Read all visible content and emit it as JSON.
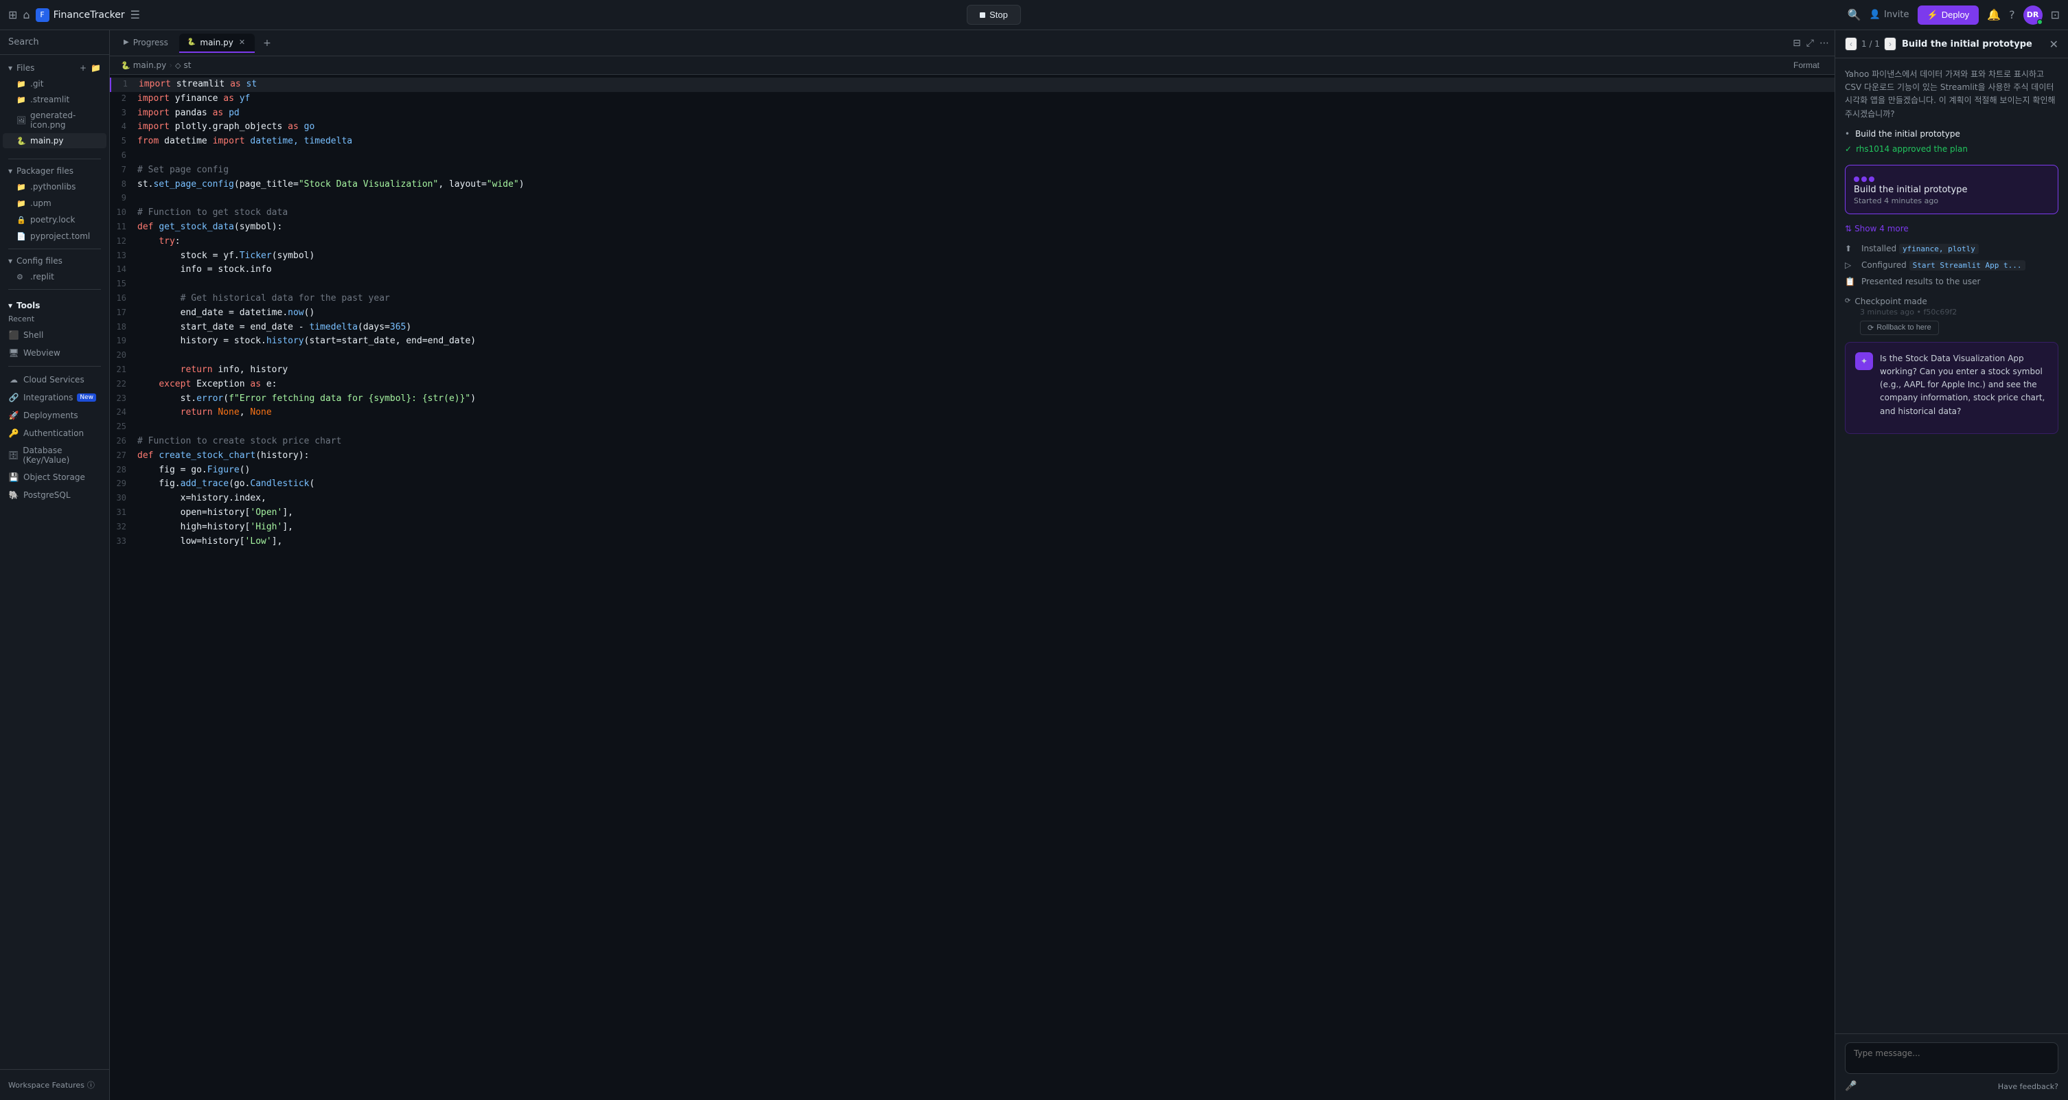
{
  "topbar": {
    "brand": "FinanceTracker",
    "stop_label": "Stop",
    "invite_label": "Invite",
    "deploy_label": "Deploy",
    "avatar_initials": "DR"
  },
  "sidebar": {
    "search_label": "Search",
    "files_section": "Files",
    "file_items": [
      {
        "name": ".git",
        "icon": "📁"
      },
      {
        "name": ".streamlit",
        "icon": "📁"
      },
      {
        "name": "generated-icon.png",
        "icon": "🖼"
      },
      {
        "name": "main.py",
        "icon": "🐍",
        "active": true
      }
    ],
    "packager_label": "Packager files",
    "packager_items": [
      {
        "name": ".pythonlibs",
        "icon": "📁"
      },
      {
        "name": ".upm",
        "icon": "📁"
      },
      {
        "name": "poetry.lock",
        "icon": "🔒"
      },
      {
        "name": "pyproject.toml",
        "icon": "📄"
      }
    ],
    "config_label": "Config files",
    "config_items": [
      {
        "name": ".replit",
        "icon": "⚙"
      }
    ],
    "tools_label": "Tools",
    "recent_label": "Recent",
    "tools_items": [
      {
        "name": "Cloud Services",
        "icon": "☁",
        "badge": ""
      },
      {
        "name": "Integrations",
        "icon": "🔗",
        "badge": "New"
      },
      {
        "name": "Deployments",
        "icon": "🚀",
        "badge": ""
      },
      {
        "name": "Authentication",
        "icon": "🔑",
        "badge": ""
      },
      {
        "name": "Database (Key/Value)",
        "icon": "🗄",
        "badge": ""
      },
      {
        "name": "Object Storage",
        "icon": "💾",
        "badge": ""
      },
      {
        "name": "PostgreSQL",
        "icon": "🐘",
        "badge": ""
      }
    ],
    "workspace_label": "Workspace Features"
  },
  "editor": {
    "tabs": [
      {
        "label": "Progress",
        "icon": "▶",
        "active": false
      },
      {
        "label": "main.py",
        "icon": "🐍",
        "active": true,
        "closeable": true
      }
    ],
    "breadcrumb": [
      {
        "label": "main.py",
        "icon": "🐍"
      },
      {
        "label": "st",
        "icon": "◇"
      }
    ],
    "format_label": "Format",
    "code_lines": [
      {
        "num": 1,
        "tokens": [
          {
            "t": "kw",
            "v": "import"
          },
          {
            "t": "var",
            "v": " streamlit "
          },
          {
            "t": "kw",
            "v": "as"
          },
          {
            "t": "import-name",
            "v": " st"
          }
        ]
      },
      {
        "num": 2,
        "tokens": [
          {
            "t": "kw",
            "v": "import"
          },
          {
            "t": "var",
            "v": " yfinance "
          },
          {
            "t": "kw",
            "v": "as"
          },
          {
            "t": "import-name",
            "v": " yf"
          }
        ]
      },
      {
        "num": 3,
        "tokens": [
          {
            "t": "kw",
            "v": "import"
          },
          {
            "t": "var",
            "v": " pandas "
          },
          {
            "t": "kw",
            "v": "as"
          },
          {
            "t": "import-name",
            "v": " pd"
          }
        ]
      },
      {
        "num": 4,
        "tokens": [
          {
            "t": "kw",
            "v": "import"
          },
          {
            "t": "var",
            "v": " plotly.graph_objects "
          },
          {
            "t": "kw",
            "v": "as"
          },
          {
            "t": "import-name",
            "v": " go"
          }
        ]
      },
      {
        "num": 5,
        "tokens": [
          {
            "t": "kw",
            "v": "from"
          },
          {
            "t": "var",
            "v": " datetime "
          },
          {
            "t": "kw",
            "v": "import"
          },
          {
            "t": "import-name",
            "v": " datetime, timedelta"
          }
        ]
      },
      {
        "num": 6,
        "tokens": []
      },
      {
        "num": 7,
        "tokens": [
          {
            "t": "comment",
            "v": "# Set page config"
          }
        ]
      },
      {
        "num": 8,
        "tokens": [
          {
            "t": "var",
            "v": "st"
          },
          {
            "t": "punc",
            "v": "."
          },
          {
            "t": "fn",
            "v": "set_page_config"
          },
          {
            "t": "punc",
            "v": "("
          },
          {
            "t": "var",
            "v": "page_title"
          },
          {
            "t": "punc",
            "v": "="
          },
          {
            "t": "str",
            "v": "\"Stock Data Visualization\""
          },
          {
            "t": "punc",
            "v": ", "
          },
          {
            "t": "var",
            "v": "layout"
          },
          {
            "t": "punc",
            "v": "="
          },
          {
            "t": "str",
            "v": "\"wide\""
          },
          {
            "t": "punc",
            "v": ")"
          }
        ]
      },
      {
        "num": 9,
        "tokens": []
      },
      {
        "num": 10,
        "tokens": [
          {
            "t": "comment",
            "v": "# Function to get stock data"
          }
        ]
      },
      {
        "num": 11,
        "tokens": [
          {
            "t": "kw",
            "v": "def"
          },
          {
            "t": "var",
            "v": " "
          },
          {
            "t": "fn",
            "v": "get_stock_data"
          },
          {
            "t": "punc",
            "v": "("
          },
          {
            "t": "var",
            "v": "symbol"
          },
          {
            "t": "punc",
            "v": "):"
          }
        ]
      },
      {
        "num": 12,
        "tokens": [
          {
            "t": "var",
            "v": "    "
          },
          {
            "t": "kw",
            "v": "try"
          },
          {
            "t": "punc",
            "v": ":"
          }
        ]
      },
      {
        "num": 13,
        "tokens": [
          {
            "t": "var",
            "v": "        stock = yf."
          },
          {
            "t": "fn",
            "v": "Ticker"
          },
          {
            "t": "punc",
            "v": "("
          },
          {
            "t": "var",
            "v": "symbol"
          },
          {
            "t": "punc",
            "v": ")"
          }
        ]
      },
      {
        "num": 14,
        "tokens": [
          {
            "t": "var",
            "v": "        info = stock.info"
          }
        ]
      },
      {
        "num": 15,
        "tokens": []
      },
      {
        "num": 16,
        "tokens": [
          {
            "t": "comment",
            "v": "        # Get historical data for the past year"
          }
        ]
      },
      {
        "num": 17,
        "tokens": [
          {
            "t": "var",
            "v": "        end_date = datetime."
          },
          {
            "t": "fn",
            "v": "now"
          },
          {
            "t": "punc",
            "v": "()"
          }
        ]
      },
      {
        "num": 18,
        "tokens": [
          {
            "t": "var",
            "v": "        start_date = end_date - "
          },
          {
            "t": "fn",
            "v": "timedelta"
          },
          {
            "t": "punc",
            "v": "("
          },
          {
            "t": "var",
            "v": "days"
          },
          {
            "t": "punc",
            "v": "="
          },
          {
            "t": "num",
            "v": "365"
          },
          {
            "t": "punc",
            "v": ")"
          }
        ]
      },
      {
        "num": 19,
        "tokens": [
          {
            "t": "var",
            "v": "        history = stock."
          },
          {
            "t": "fn",
            "v": "history"
          },
          {
            "t": "punc",
            "v": "("
          },
          {
            "t": "var",
            "v": "start"
          },
          {
            "t": "punc",
            "v": "="
          },
          {
            "t": "var",
            "v": "start_date, end"
          },
          {
            "t": "punc",
            "v": "="
          },
          {
            "t": "var",
            "v": "end_date"
          },
          {
            "t": "punc",
            "v": ")"
          }
        ]
      },
      {
        "num": 20,
        "tokens": []
      },
      {
        "num": 21,
        "tokens": [
          {
            "t": "kw",
            "v": "        return"
          },
          {
            "t": "var",
            "v": " info, history"
          }
        ]
      },
      {
        "num": 22,
        "tokens": [
          {
            "t": "var",
            "v": "    "
          },
          {
            "t": "kw",
            "v": "except"
          },
          {
            "t": "var",
            "v": " Exception "
          },
          {
            "t": "kw",
            "v": "as"
          },
          {
            "t": "var",
            "v": " e:"
          }
        ]
      },
      {
        "num": 23,
        "tokens": [
          {
            "t": "var",
            "v": "        st."
          },
          {
            "t": "fn",
            "v": "error"
          },
          {
            "t": "punc",
            "v": "("
          },
          {
            "t": "str",
            "v": "f\"Error fetching data for {symbol}: {str(e)}\""
          },
          {
            "t": "punc",
            "v": ")"
          }
        ]
      },
      {
        "num": 24,
        "tokens": [
          {
            "t": "kw",
            "v": "        return"
          },
          {
            "t": "var",
            "v": " "
          },
          {
            "t": "kw2",
            "v": "None"
          },
          {
            "t": "punc",
            "v": ", "
          },
          {
            "t": "kw2",
            "v": "None"
          }
        ]
      },
      {
        "num": 25,
        "tokens": []
      },
      {
        "num": 26,
        "tokens": [
          {
            "t": "comment",
            "v": "# Function to create stock price chart"
          }
        ]
      },
      {
        "num": 27,
        "tokens": [
          {
            "t": "kw",
            "v": "def"
          },
          {
            "t": "var",
            "v": " "
          },
          {
            "t": "fn",
            "v": "create_stock_chart"
          },
          {
            "t": "punc",
            "v": "("
          },
          {
            "t": "var",
            "v": "history"
          },
          {
            "t": "punc",
            "v": "):"
          }
        ]
      },
      {
        "num": 28,
        "tokens": [
          {
            "t": "var",
            "v": "    fig = go."
          },
          {
            "t": "fn",
            "v": "Figure"
          },
          {
            "t": "punc",
            "v": "()"
          }
        ]
      },
      {
        "num": 29,
        "tokens": [
          {
            "t": "var",
            "v": "    fig."
          },
          {
            "t": "fn",
            "v": "add_trace"
          },
          {
            "t": "punc",
            "v": "("
          },
          {
            "t": "var",
            "v": "go."
          },
          {
            "t": "fn",
            "v": "Candlestick"
          },
          {
            "t": "punc",
            "v": "("
          }
        ]
      },
      {
        "num": 30,
        "tokens": [
          {
            "t": "var",
            "v": "        x=history.index,"
          }
        ]
      },
      {
        "num": 31,
        "tokens": [
          {
            "t": "var",
            "v": "        open=history"
          },
          {
            "t": "punc",
            "v": "["
          },
          {
            "t": "str",
            "v": "'Open'"
          },
          {
            "t": "punc",
            "v": "],"
          }
        ]
      },
      {
        "num": 32,
        "tokens": [
          {
            "t": "var",
            "v": "        high=history"
          },
          {
            "t": "punc",
            "v": "["
          },
          {
            "t": "str",
            "v": "'High'"
          },
          {
            "t": "punc",
            "v": "],"
          }
        ]
      },
      {
        "num": 33,
        "tokens": [
          {
            "t": "var",
            "v": "        low=history"
          },
          {
            "t": "punc",
            "v": "["
          },
          {
            "t": "str",
            "v": "'Low'"
          },
          {
            "t": "punc",
            "v": "],"
          }
        ]
      }
    ]
  },
  "right_panel": {
    "counter": "1 / 1",
    "title": "Build the initial prototype",
    "plan_text": "Yahoo 파이낸스에서 데이터 가져와 표와 차트로 표시하고 CSV 다운로드 기능이 있는 Streamlit을 사용한 주식 데이터 시각화 앱을 만들겠습니다. 이 계획이 적절해 보이는지 확인해 주시겠습니까?",
    "plan_bullet": "Build the initial prototype",
    "approved_text": "rhs1014 approved the plan",
    "task_title": "Build the initial prototype",
    "task_time": "Started 4 minutes ago",
    "show_more_label": "Show 4 more",
    "sub_items": [
      {
        "icon": "⬆",
        "text": "Installed yfinance, plotly"
      },
      {
        "icon": "▷",
        "text": "Configured Start Streamlit App t..."
      },
      {
        "icon": "📋",
        "text": "Presented results to the user"
      }
    ],
    "checkpoint_title": "Checkpoint made",
    "checkpoint_meta": "3 minutes ago • f50c69f2",
    "rollback_label": "Rollback to here",
    "agent_message": "Is the Stock Data Visualization App working? Can you enter a stock symbol (e.g., AAPL for Apple Inc.) and see the company information, stock price chart, and historical data?",
    "chat_placeholder": "Type message...",
    "feedback_label": "Have feedback?"
  }
}
